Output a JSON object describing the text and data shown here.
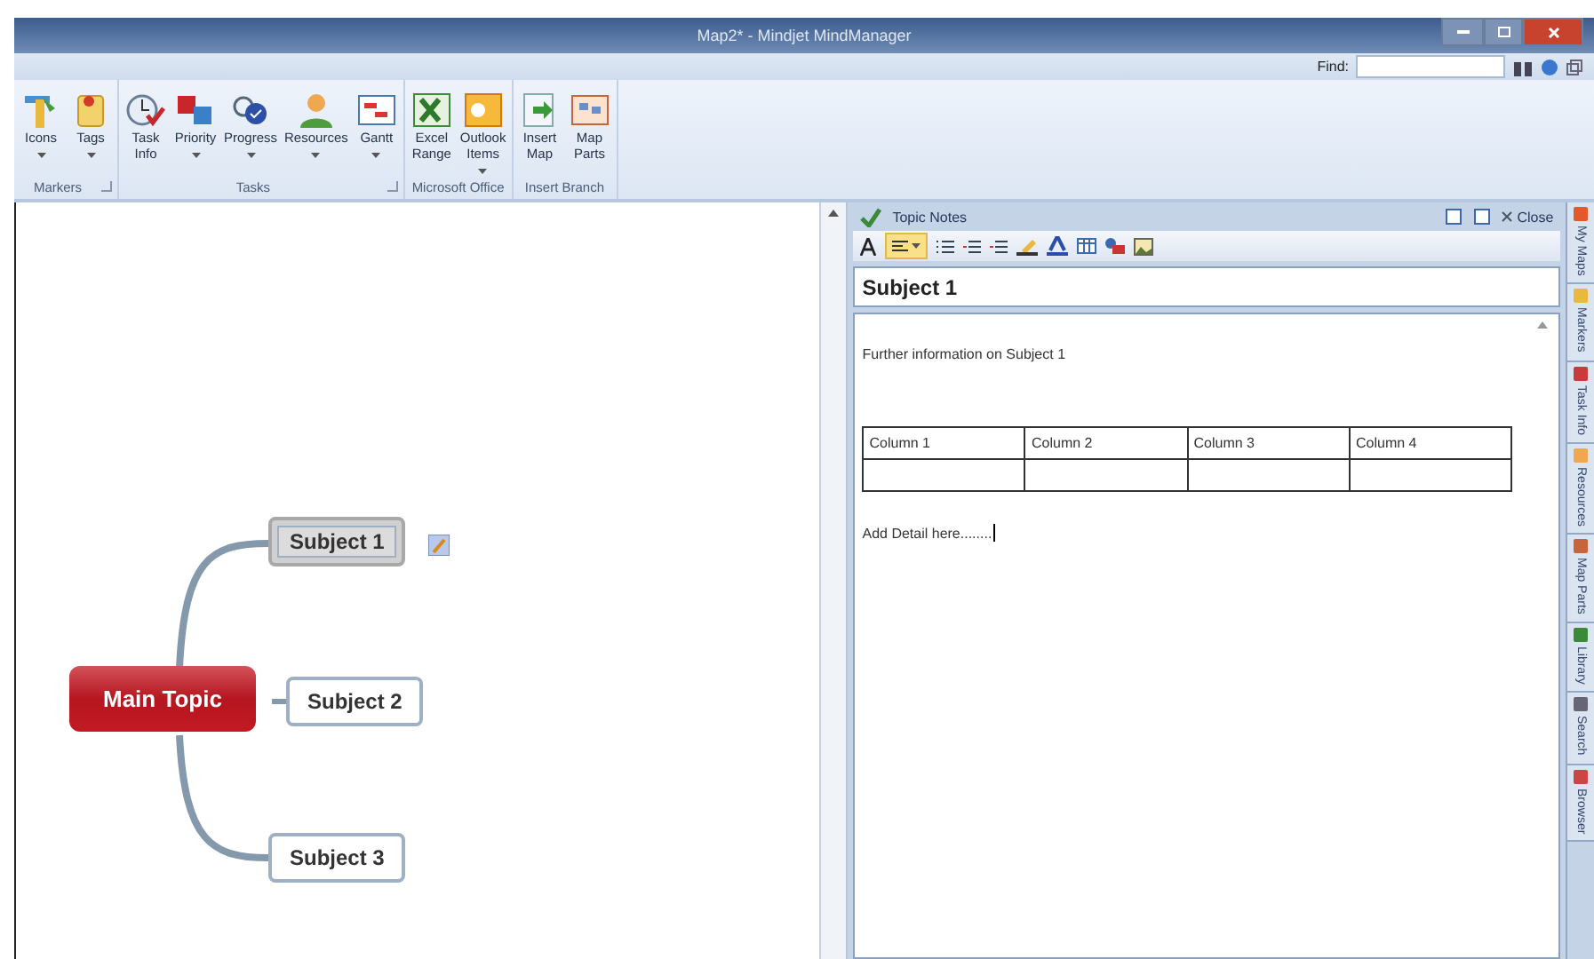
{
  "window": {
    "title": "Map2* - Mindjet MindManager"
  },
  "find": {
    "label": "Find:"
  },
  "ribbon": [
    {
      "name": "Markers",
      "launcher": true,
      "buttons": [
        {
          "label": "Icons",
          "dropdown": true
        },
        {
          "label": "Tags",
          "dropdown": true
        }
      ]
    },
    {
      "name": "Tasks",
      "launcher": true,
      "buttons": [
        {
          "label": "Task\nInfo",
          "dropdown": false
        },
        {
          "label": "Priority",
          "dropdown": true
        },
        {
          "label": "Progress",
          "dropdown": true
        },
        {
          "label": "Resources",
          "dropdown": true
        },
        {
          "label": "Gantt",
          "dropdown": true
        }
      ]
    },
    {
      "name": "Microsoft Office",
      "launcher": false,
      "buttons": [
        {
          "label": "Excel\nRange",
          "dropdown": false
        },
        {
          "label": "Outlook\nItems",
          "dropdown": true
        }
      ]
    },
    {
      "name": "Insert Branch",
      "launcher": false,
      "buttons": [
        {
          "label": "Insert\nMap",
          "dropdown": false
        },
        {
          "label": "Map\nParts",
          "dropdown": false
        }
      ]
    }
  ],
  "map": {
    "main_topic": "Main Topic",
    "subjects": [
      {
        "label": "Subject 1",
        "selected": true,
        "has_note": true
      },
      {
        "label": "Subject 2",
        "selected": false,
        "has_note": false
      },
      {
        "label": "Subject 3",
        "selected": false,
        "has_note": false
      }
    ]
  },
  "notes": {
    "title": "Topic Notes",
    "close": "Close",
    "align_selected": true,
    "subject": "Subject 1",
    "paragraph": "Further information on Subject 1",
    "table": {
      "columns": [
        "Column 1",
        "Column 2",
        "Column 3",
        "Column 4"
      ]
    },
    "detail": "Add Detail here........"
  },
  "side_tabs": [
    {
      "label": "My Maps"
    },
    {
      "label": "Markers"
    },
    {
      "label": "Task Info"
    },
    {
      "label": "Resources"
    },
    {
      "label": "Map Parts"
    },
    {
      "label": "Library"
    },
    {
      "label": "Search"
    },
    {
      "label": "Browser"
    }
  ]
}
